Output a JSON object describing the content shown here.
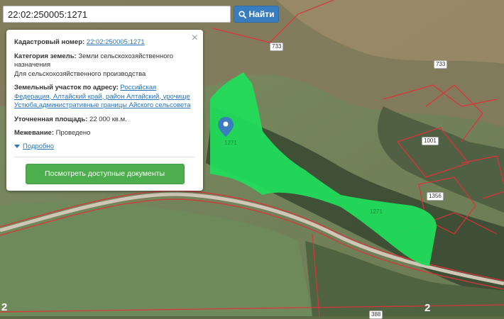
{
  "search": {
    "value": "22:02:250005:1271",
    "button_label": "Найти"
  },
  "popup": {
    "cadastral_label": "Кадастровый номер:",
    "cadastral_number": "22:02:250005:1271",
    "category_label": "Категория земель:",
    "category_value": "Земли сельскохозяйственного назначения",
    "category_sub": "Для сельскохозяйственного производства",
    "address_label": "Земельный участок по адресу:",
    "address_value": "Российская Федерация, Алтайский край, район Алтайский, урочище Устюба,административные границы Айского сельсовета",
    "area_label": "Уточненная площадь:",
    "area_value": "22 000 кв.м.",
    "survey_label": "Межевание:",
    "survey_value": "Проведено",
    "more_label": "Подробно",
    "docs_button": "Посмотреть доступные документы"
  },
  "map": {
    "plot_labels": [
      "1271",
      "1271"
    ],
    "neighbor_labels": [
      "733",
      "733",
      "1001",
      "1356",
      "388"
    ],
    "edge_numbers": [
      "2",
      "2"
    ],
    "colors": {
      "parcel_fill": "#1fe05a",
      "boundary": "#e0303a",
      "marker": "#3a7dbf"
    }
  }
}
